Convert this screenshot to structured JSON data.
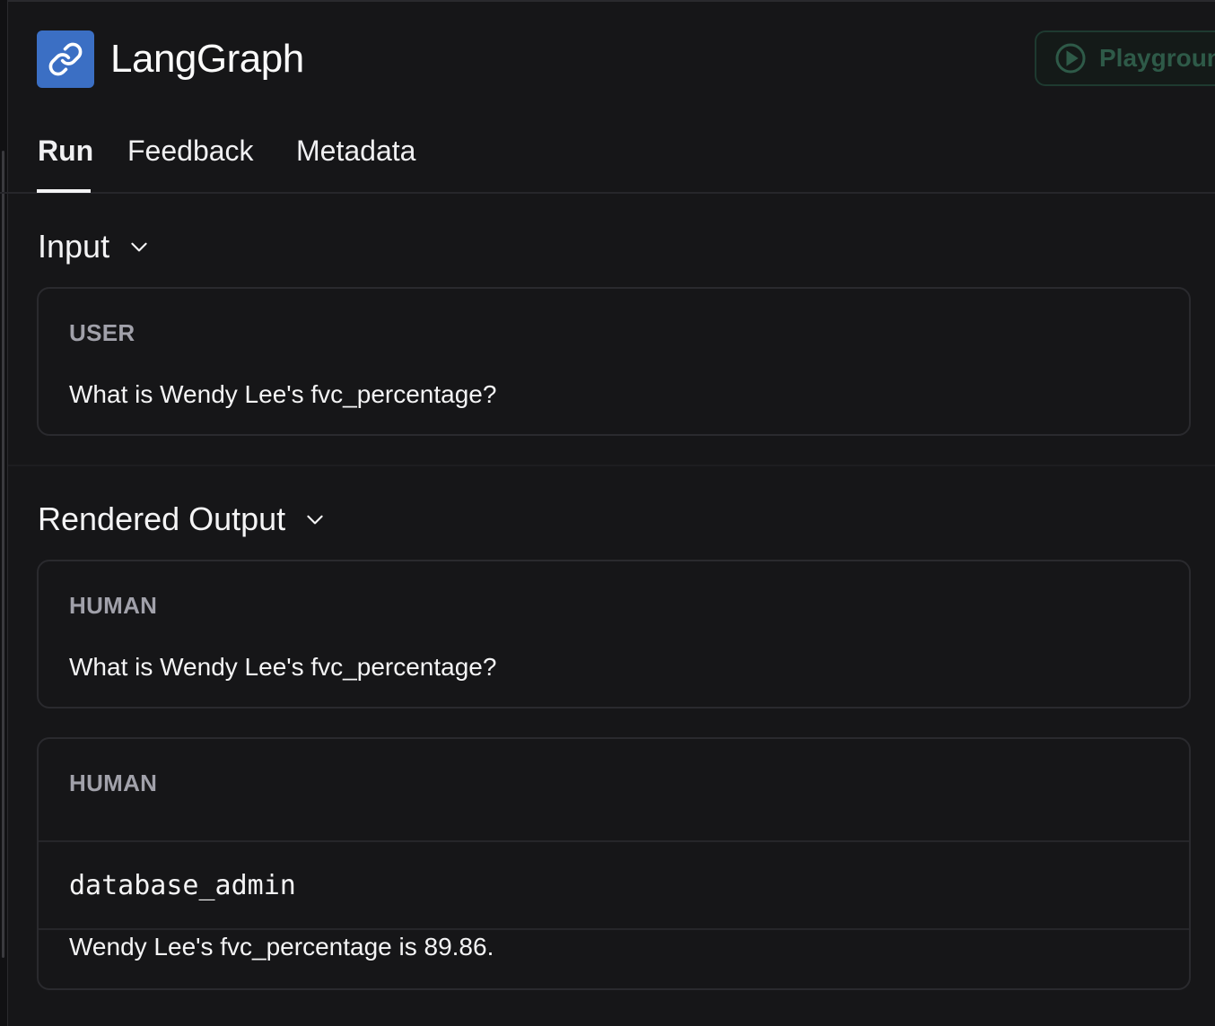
{
  "app": {
    "title": "LangGraph",
    "logo_icon": "link-icon",
    "playground_label": "Playground",
    "playground_icon": "play-circle-icon"
  },
  "tabs": [
    {
      "label": "Run",
      "active": true
    },
    {
      "label": "Feedback",
      "active": false
    },
    {
      "label": "Metadata",
      "active": false
    }
  ],
  "input": {
    "heading": "Input",
    "toggle_icon": "chevron-down-icon",
    "message": {
      "role": "USER",
      "text": "What is Wendy Lee's fvc_percentage?"
    }
  },
  "output": {
    "heading": "Rendered Output",
    "toggle_icon": "chevron-down-icon",
    "messages": [
      {
        "role": "HUMAN",
        "text": "What is Wendy Lee's fvc_percentage?"
      },
      {
        "role": "HUMAN",
        "name": "database_admin",
        "text": "Wendy Lee's fvc_percentage is 89.86."
      }
    ]
  },
  "colors": {
    "background": "#161618",
    "logo": "#3b6fc4",
    "playground_accent": "#2e5a48"
  }
}
